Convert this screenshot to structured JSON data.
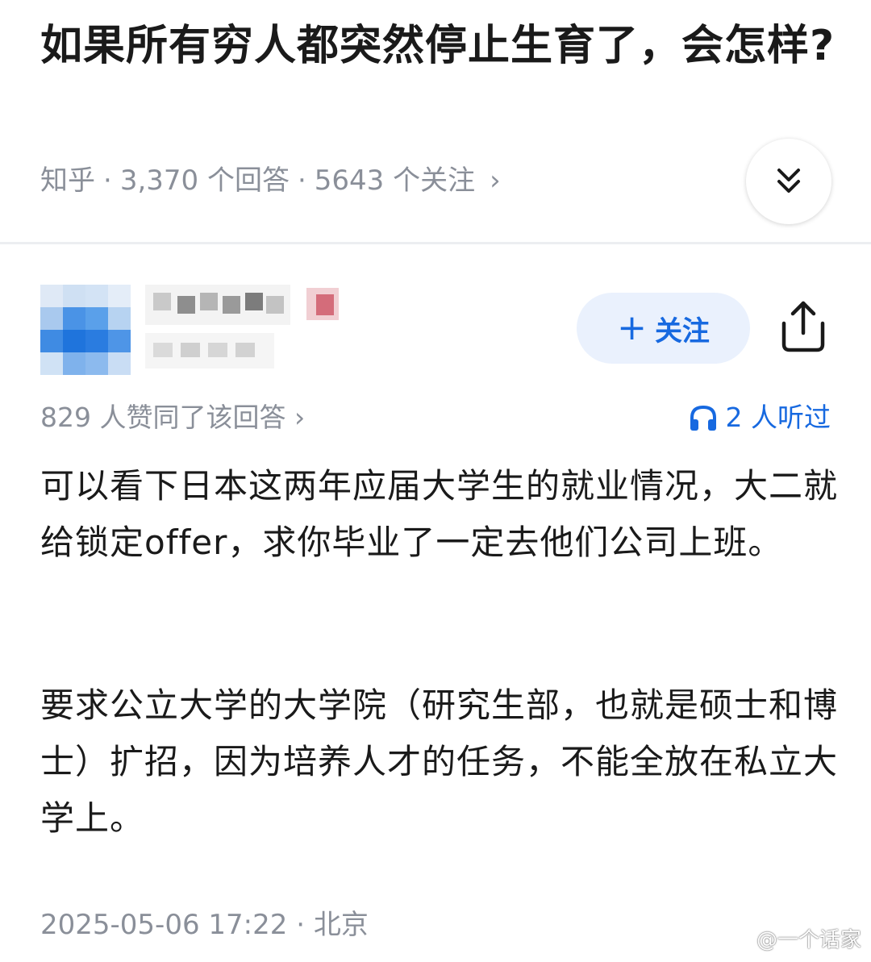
{
  "question": {
    "title": "如果所有穷人都突然停止生育了，会怎样?",
    "source": "知乎",
    "answer_count": "3,370 个回答",
    "follower_count": "5643 个关注",
    "meta_separator": "·",
    "meta_chevron": "›",
    "expand_icon": "double-chevron-down-icon"
  },
  "author": {
    "avatar_icon": "avatar-pixelated",
    "follow_plus": "+",
    "follow_label": "关注",
    "share_icon": "share-icon"
  },
  "answer": {
    "likes": "829 人赞同了该回答 ›",
    "listened": "2 人听过",
    "paragraphs": [
      "可以看下日本这两年应届大学生的就业情况，大二就给锁定offer，求你毕业了一定去他们公司上班。",
      "要求公立大学的大学院（研究生部，也就是硕士和博士）扩招，因为培养人才的任务，不能全放在私立大学上。"
    ],
    "date": "2025-05-06 17:22",
    "location_separator": "·",
    "location": "北京"
  },
  "watermark": {
    "text": "@一个话家",
    "icon": "weibo-icon"
  },
  "colors": {
    "accent": "#1769e0",
    "follow_bg": "#eaf1fd",
    "meta_gray": "#8a8f99",
    "divider": "#eceef1"
  }
}
